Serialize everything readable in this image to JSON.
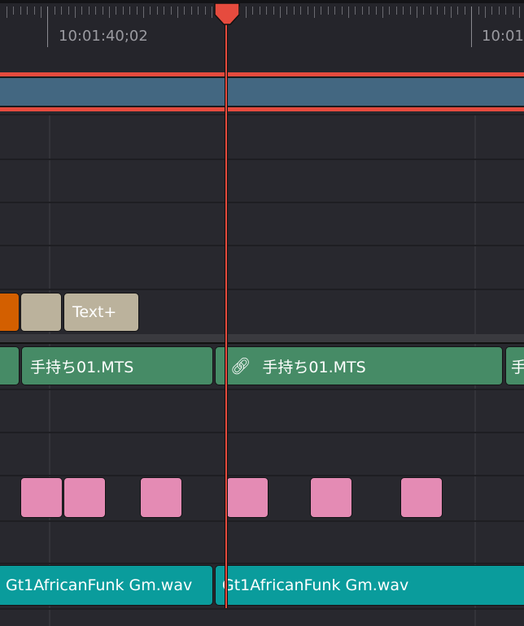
{
  "ruler": {
    "timecodes": [
      "10:01:40;02",
      "10:01"
    ]
  },
  "video_clips": [
    {
      "label": ""
    },
    {
      "label": "手持ち01.MTS"
    },
    {
      "label": "手持ち01.MTS",
      "linked": true
    },
    {
      "label": "手"
    }
  ],
  "title_clips": [
    {
      "label": ""
    },
    {
      "label": "Text+"
    }
  ],
  "audio_clips": [
    {
      "label": "Gt1AfricanFunk Gm.wav"
    },
    {
      "label": "Gt1AfricanFunk Gm.wav"
    }
  ],
  "colors": {
    "playhead": "#e64b3e",
    "video": "#468b66",
    "audio": "#0a9c9c",
    "title": "#bbb29c",
    "generator": "#d35f00",
    "pink": "#e48bb4"
  }
}
